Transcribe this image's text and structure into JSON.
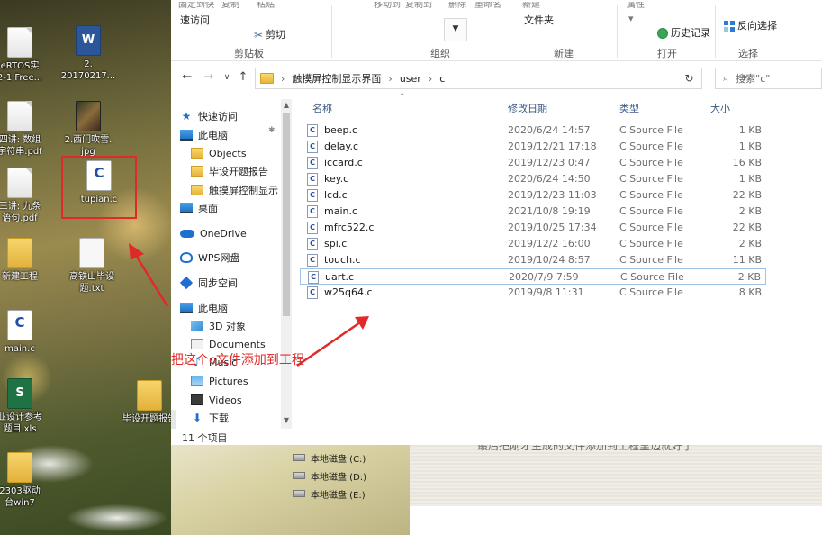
{
  "desktop": {
    "items": [
      {
        "label": "eRTOS实\n2-1 Free..."
      },
      {
        "label": "2.\n20170217..."
      },
      {
        "label": "四讲: 数组\n字符串.pdf"
      },
      {
        "label": "2.西门吹雪.\njpg"
      },
      {
        "label": "三讲: 九条\n语句.pdf"
      },
      {
        "label": "tupian.c"
      },
      {
        "label": "新建工程"
      },
      {
        "label": "高铁山毕设\n题.txt"
      },
      {
        "label": "main.c"
      },
      {
        "label": "业设计参考\n题目.xls"
      },
      {
        "label": "毕设开题报告"
      },
      {
        "label": "2303驱动\n台win7"
      }
    ]
  },
  "ribbon": {
    "cut_texts": [
      "固定到快",
      "复制",
      "粘贴",
      "移动到",
      "复制到",
      "删除",
      "重命名",
      "新建",
      "属性"
    ],
    "copy_path_label": "速访问",
    "cut_label": "剪切",
    "new_folder_label": "文件夹",
    "history_label": "历史记录",
    "invert_label": "反向选择",
    "groups": {
      "clipboard": "剪贴板",
      "organize": "组织",
      "new": "新建",
      "open": "打开",
      "select": "选择"
    }
  },
  "address": {
    "crumbs": [
      "触摸屏控制显示界面",
      "user",
      "c"
    ],
    "search_placeholder": "搜索\"c\""
  },
  "nav": {
    "quick_access": "快速访问",
    "this_pc": "此电脑",
    "objects": "Objects",
    "thesis": "毕设开题报告",
    "touch": "触摸屏控制显示",
    "desktop": "桌面",
    "onedrive": "OneDrive",
    "wps": "WPS网盘",
    "sync": "同步空间",
    "this_pc2": "此电脑",
    "objects3d": "3D 对象",
    "documents": "Documents",
    "music": "Music",
    "pictures": "Pictures",
    "videos": "Videos",
    "downloads": "下载"
  },
  "list": {
    "headers": {
      "name": "名称",
      "date": "修改日期",
      "type": "类型",
      "size": "大小"
    },
    "files": [
      {
        "name": "beep.c",
        "date": "2020/6/24 14:57",
        "type": "C Source File",
        "size": "1 KB"
      },
      {
        "name": "delay.c",
        "date": "2019/12/21 17:18",
        "type": "C Source File",
        "size": "1 KB"
      },
      {
        "name": "iccard.c",
        "date": "2019/12/23 0:47",
        "type": "C Source File",
        "size": "16 KB"
      },
      {
        "name": "key.c",
        "date": "2020/6/24 14:50",
        "type": "C Source File",
        "size": "1 KB"
      },
      {
        "name": "lcd.c",
        "date": "2019/12/23 11:03",
        "type": "C Source File",
        "size": "22 KB"
      },
      {
        "name": "main.c",
        "date": "2021/10/8 19:19",
        "type": "C Source File",
        "size": "2 KB"
      },
      {
        "name": "mfrc522.c",
        "date": "2019/10/25 17:34",
        "type": "C Source File",
        "size": "22 KB"
      },
      {
        "name": "spi.c",
        "date": "2019/12/2 16:00",
        "type": "C Source File",
        "size": "2 KB"
      },
      {
        "name": "touch.c",
        "date": "2019/10/24 8:57",
        "type": "C Source File",
        "size": "11 KB"
      },
      {
        "name": "uart.c",
        "date": "2020/7/9 7:59",
        "type": "C Source File",
        "size": "2 KB"
      },
      {
        "name": "w25q64.c",
        "date": "2019/9/8 11:31",
        "type": "C Source File",
        "size": "8 KB"
      }
    ],
    "selected_index": 9
  },
  "status": {
    "item_count": "11 个项目"
  },
  "drives": [
    {
      "label": "本地磁盘 (C:)"
    },
    {
      "label": "本地磁盘 (D:)"
    },
    {
      "label": "本地磁盘 (E:)"
    }
  ],
  "bottom_pane_text": "最后把刚才生成的文件添加到工程里边就好了",
  "annotation": {
    "text": "把这个c文件添加到工程",
    "color": "#e02a2a"
  },
  "colors": {
    "selection_border": "#9fc3e6",
    "header_text": "#3c5a86",
    "accent_blue": "#1e6fd0"
  }
}
